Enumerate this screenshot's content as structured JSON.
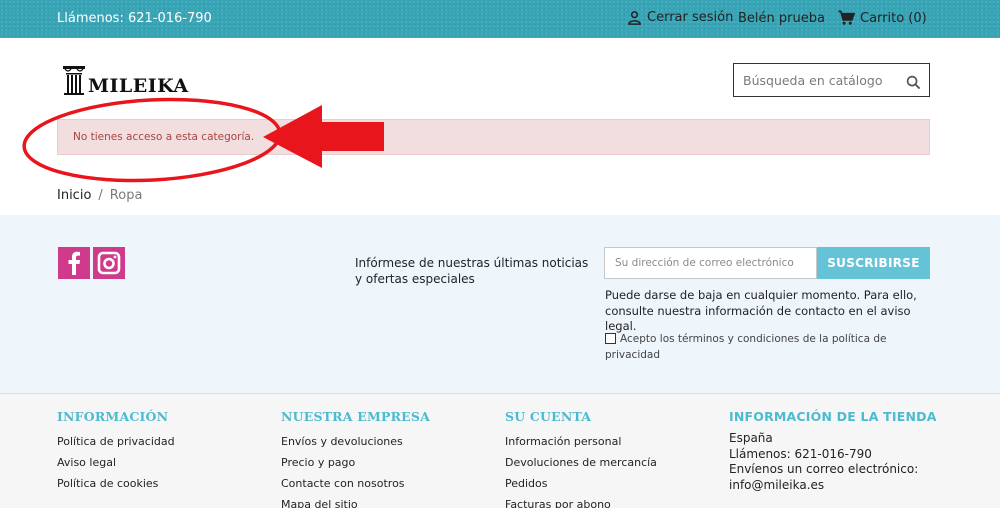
{
  "topbar": {
    "phone": "Llámenos: 621-016-790",
    "logout": "Cerrar sesión",
    "user": "Belén prueba",
    "cart": "Carrito (0)"
  },
  "header": {
    "logo_text": "MILEIKA",
    "search_placeholder": "Búsqueda en catálogo"
  },
  "alert": {
    "message": "No tienes acceso a esta categoría."
  },
  "breadcrumb": {
    "home": "Inicio",
    "separator": "/",
    "current": "Ropa"
  },
  "newsletter": {
    "text": "Infórmese de nuestras últimas noticias y ofertas especiales",
    "email_placeholder": "Su dirección de correo electrónico",
    "subscribe": "SUSCRIBIRSE",
    "note": "Puede darse de baja en cualquier momento. Para ello, consulte nuestra información de contacto en el aviso legal.",
    "consent": "Acepto los términos y condiciones de la política de privacidad"
  },
  "footer": {
    "informacion": {
      "title": "INFORMACIÓN",
      "links": [
        "Política de privacidad",
        "Aviso legal",
        "Política de cookies"
      ]
    },
    "empresa": {
      "title": "NUESTRA EMPRESA",
      "links": [
        "Envíos y devoluciones",
        "Precio y pago",
        "Contacte con nosotros",
        "Mapa del sitio"
      ]
    },
    "cuenta": {
      "title": "SU CUENTA",
      "links": [
        "Información personal",
        "Devoluciones de mercancía",
        "Pedidos",
        "Facturas por abono"
      ]
    },
    "tienda": {
      "title": "INFORMACIÓN DE LA TIENDA",
      "country": "España",
      "phone": "Llámenos: 621-016-790",
      "email_label": "Envíenos un correo electrónico:",
      "email": "info@mileika.es"
    }
  },
  "colors": {
    "topbar": "#38a5b7",
    "accent": "#4cbbd0",
    "alert_bg": "#f2dede",
    "alert_text": "#a94442",
    "social": "#cf3b8a",
    "annotation": "#e8151c"
  },
  "icons": [
    "user-icon",
    "cart-icon",
    "search-icon",
    "facebook-icon",
    "instagram-icon",
    "column-logo-icon"
  ]
}
